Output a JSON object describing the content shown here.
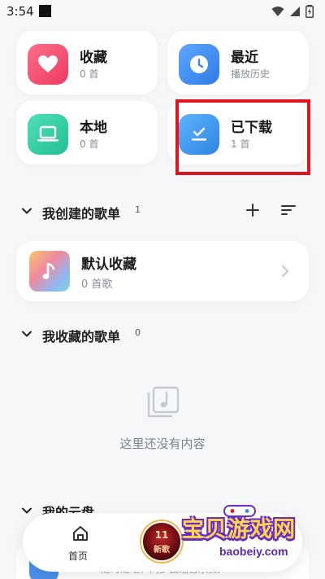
{
  "status_bar": {
    "time": "3:54"
  },
  "quick_cards": {
    "favorites": {
      "title": "收藏",
      "subtitle": "0 首",
      "color": "#f2506f"
    },
    "recent": {
      "title": "最近",
      "subtitle": "播放历史",
      "color": "#3d8cf5"
    },
    "local": {
      "title": "本地",
      "subtitle": "0 首",
      "color": "#2fcfa2"
    },
    "downloaded": {
      "title": "已下载",
      "subtitle": "1 首",
      "color": "#3a95ec"
    }
  },
  "created_playlists": {
    "title": "我创建的歌单",
    "count": "1",
    "items": [
      {
        "title": "默认收藏",
        "subtitle": "0 首歌"
      }
    ]
  },
  "collected_playlists": {
    "title": "我收藏的歌单",
    "count": "0",
    "empty_text": "这里还没有内容"
  },
  "cloud": {
    "title": "我的云盘",
    "subtitle": "随时随地，同步云端音乐资产"
  },
  "bottom_nav": {
    "home_label": "首页",
    "disc_number": "11",
    "disc_caption": "新歌"
  },
  "watermark": {
    "title": "宝贝游戏网",
    "url": "baobeiy.com"
  },
  "colors": {
    "highlight": "#e0141e",
    "background": "#f6f7f9"
  }
}
